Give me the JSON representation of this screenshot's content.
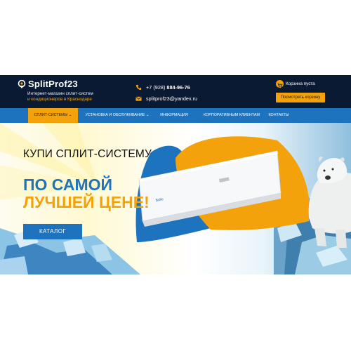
{
  "header": {
    "logo_text": "SplitProf23",
    "tagline_1": "Интернет-магазин сплит-систем",
    "tagline_2": "и кондиционеров в Краснодаре",
    "phone_prefix": "+7 (928)",
    "phone_number": "884-96-76",
    "email": "splitprof23@yandex.ru",
    "cart_status": "Корзина пуста",
    "view_cart_label": "Посмотреть корзину"
  },
  "nav": {
    "items": [
      {
        "label": "Сплит-системы ⌄"
      },
      {
        "label": "Установка и обслуживание ⌄"
      },
      {
        "label": "Информация"
      },
      {
        "label": "Корпоративным клиентам"
      },
      {
        "label": "Контакты"
      }
    ]
  },
  "hero": {
    "line1": "КУПИ СПЛИТ-СИСТЕМУ",
    "line2": "ПО САМОЙ",
    "line3": "ЛУЧШЕЙ ЦЕНЕ!",
    "catalog_label": "КАТАЛОГ",
    "unit_brand": "Ballu"
  },
  "colors": {
    "header_bg": "#0b1a33",
    "nav_bg": "#1e73be",
    "accent": "#f3a20c",
    "brand_blue": "#1e73be"
  },
  "icons": {
    "logo": "location-pin-icon",
    "phone": "phone-icon",
    "email": "envelope-icon",
    "cart": "cart-icon",
    "dropdown": "chevron-down-icon"
  }
}
